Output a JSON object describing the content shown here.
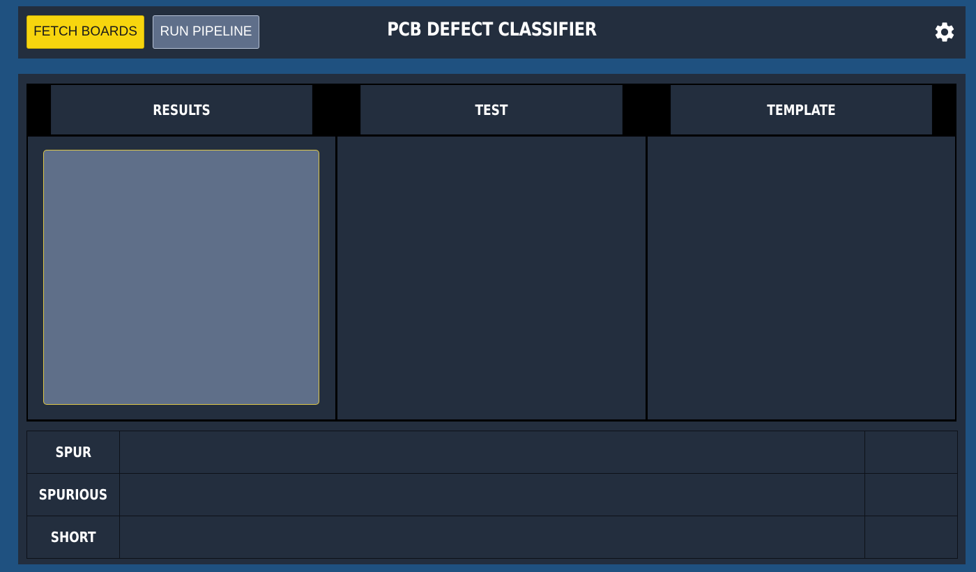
{
  "header": {
    "fetch_label": "FETCH BOARDS",
    "run_label": "RUN PIPELINE",
    "title": "PCB DEFECT CLASSIFIER",
    "settings_icon": "gear-icon"
  },
  "panels": {
    "columns": [
      {
        "label": "RESULTS"
      },
      {
        "label": "TEST"
      },
      {
        "label": "TEMPLATE"
      }
    ]
  },
  "defects": {
    "rows": [
      {
        "label": "SPUR",
        "value": "",
        "count": ""
      },
      {
        "label": "SPURIOUS",
        "value": "",
        "count": ""
      },
      {
        "label": "SHORT",
        "value": "",
        "count": ""
      }
    ]
  },
  "colors": {
    "background": "#1f5180",
    "surface": "#232e3e",
    "accent": "#f7d50e",
    "secondary_button": "#5f6f8a"
  }
}
